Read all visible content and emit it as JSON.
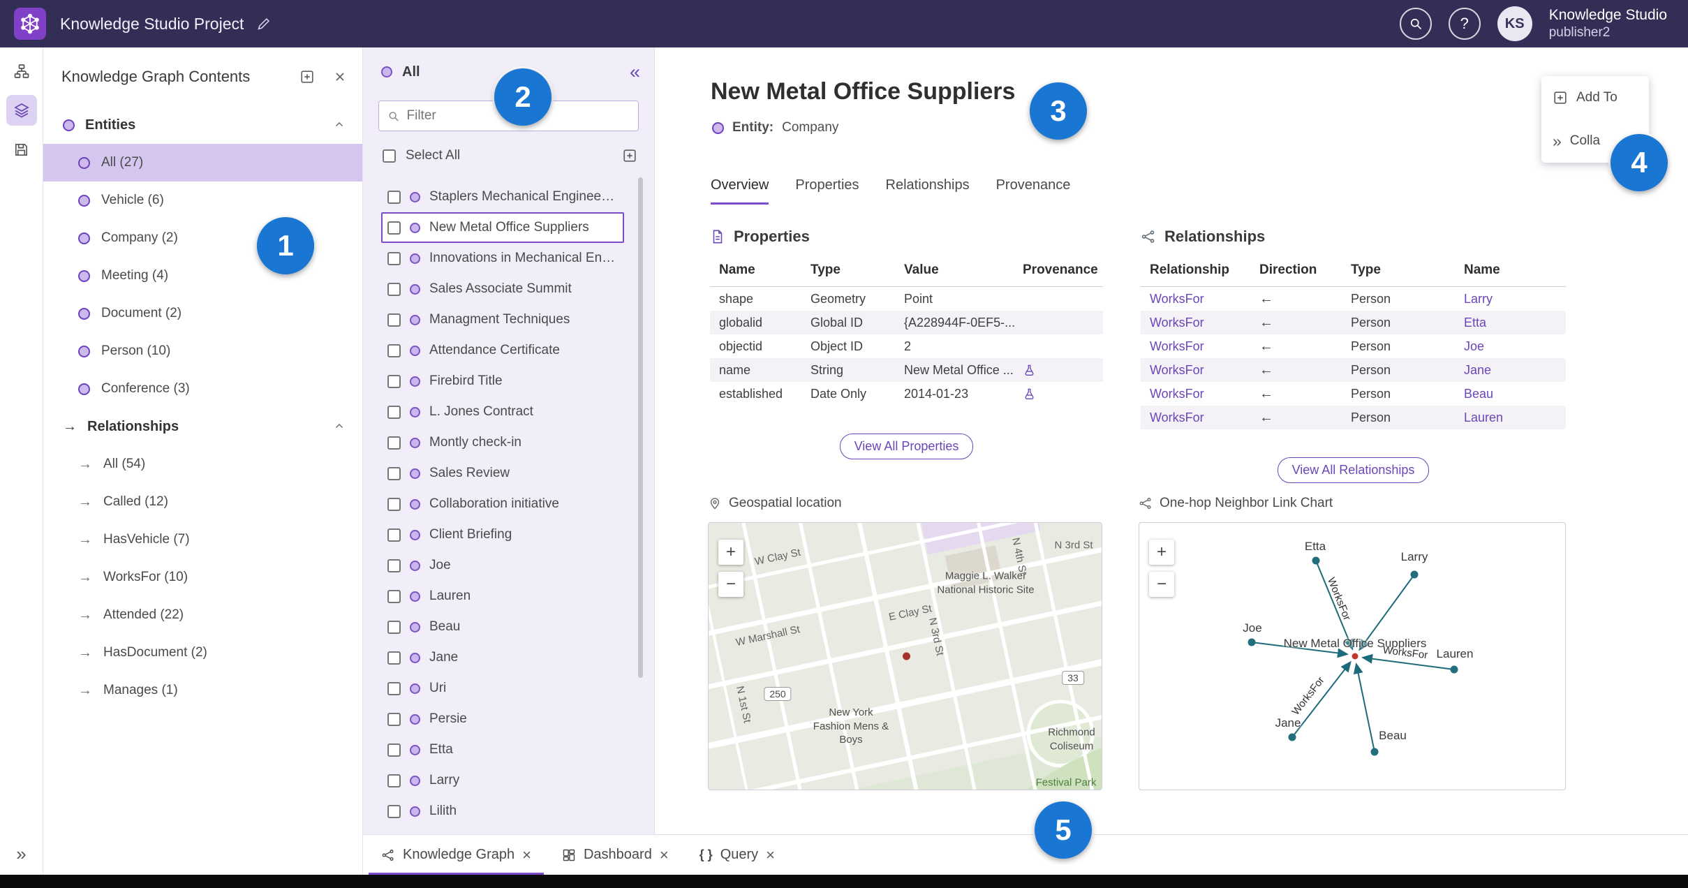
{
  "badges": [
    "1",
    "2",
    "3",
    "4",
    "5"
  ],
  "icons": {
    "help": "?",
    "arrow_right": "→",
    "collapse_double": "«",
    "expand_double": "»",
    "close": "×",
    "zoom_in": "+",
    "zoom_out": "−",
    "braces": "{ }"
  },
  "topbar": {
    "title": "Knowledge Studio Project",
    "avatar_initials": "KS",
    "app_name": "Knowledge Studio",
    "user_name": "publisher2"
  },
  "contents_panel": {
    "title": "Knowledge Graph Contents",
    "entities_header": "Entities",
    "entities": [
      {
        "label": "All (27)",
        "state": "selected"
      },
      {
        "label": "Vehicle (6)"
      },
      {
        "label": "Company (2)"
      },
      {
        "label": "Meeting (4)"
      },
      {
        "label": "Document (2)"
      },
      {
        "label": "Person (10)"
      },
      {
        "label": "Conference (3)"
      }
    ],
    "relationships_header": "Relationships",
    "relationships": [
      {
        "label": "All (54)"
      },
      {
        "label": "Called (12)"
      },
      {
        "label": "HasVehicle (7)"
      },
      {
        "label": "WorksFor (10)"
      },
      {
        "label": "Attended (22)"
      },
      {
        "label": "HasDocument (2)"
      },
      {
        "label": "Manages (1)"
      }
    ]
  },
  "list_panel": {
    "header": "All",
    "filter_placeholder": "Filter",
    "select_all_label": "Select All",
    "items": [
      {
        "label": "Staplers Mechanical Engineering"
      },
      {
        "label": "New Metal Office Suppliers",
        "state": "selected"
      },
      {
        "label": "Innovations in Mechanical Engin..."
      },
      {
        "label": "Sales Associate Summit"
      },
      {
        "label": "Managment Techniques"
      },
      {
        "label": "Attendance Certificate"
      },
      {
        "label": "Firebird Title"
      },
      {
        "label": "L. Jones Contract"
      },
      {
        "label": "Montly check-in"
      },
      {
        "label": "Sales Review"
      },
      {
        "label": "Collaboration initiative"
      },
      {
        "label": "Client Briefing"
      },
      {
        "label": "Joe"
      },
      {
        "label": "Lauren"
      },
      {
        "label": "Beau"
      },
      {
        "label": "Jane"
      },
      {
        "label": "Uri"
      },
      {
        "label": "Persie"
      },
      {
        "label": "Etta"
      },
      {
        "label": "Larry"
      },
      {
        "label": "Lilith"
      }
    ]
  },
  "detail": {
    "title": "New Metal Office Suppliers",
    "entity_key": "Entity:",
    "entity_value": "Company",
    "tabs": [
      {
        "label": "Overview",
        "state": "active"
      },
      {
        "label": "Properties"
      },
      {
        "label": "Relationships"
      },
      {
        "label": "Provenance"
      }
    ],
    "properties": {
      "heading": "Properties",
      "columns": {
        "name": "Name",
        "type": "Type",
        "value": "Value",
        "provenance": "Provenance"
      },
      "rows": [
        {
          "name": "shape",
          "type": "Geometry",
          "value": "Point"
        },
        {
          "name": "globalid",
          "type": "Global ID",
          "value": "{A228944F-0EF5-..."
        },
        {
          "name": "objectid",
          "type": "Object ID",
          "value": "2"
        },
        {
          "name": "name",
          "type": "String",
          "value": "New Metal Office ...",
          "state": "has-prov"
        },
        {
          "name": "established",
          "type": "Date Only",
          "value": "2014-01-23",
          "state": "has-prov"
        }
      ],
      "view_all_label": "View All Properties"
    },
    "relationships": {
      "heading": "Relationships",
      "columns": {
        "relationship": "Relationship",
        "direction": "Direction",
        "type": "Type",
        "name": "Name"
      },
      "rows": [
        {
          "relationship": "WorksFor",
          "direction": "←",
          "type": "Person",
          "name": "Larry"
        },
        {
          "relationship": "WorksFor",
          "direction": "←",
          "type": "Person",
          "name": "Etta"
        },
        {
          "relationship": "WorksFor",
          "direction": "←",
          "type": "Person",
          "name": "Joe"
        },
        {
          "relationship": "WorksFor",
          "direction": "←",
          "type": "Person",
          "name": "Jane"
        },
        {
          "relationship": "WorksFor",
          "direction": "←",
          "type": "Person",
          "name": "Beau"
        },
        {
          "relationship": "WorksFor",
          "direction": "←",
          "type": "Person",
          "name": "Lauren"
        }
      ],
      "view_all_label": "View All Relationships"
    },
    "map": {
      "heading": "Geospatial location",
      "labels": {
        "n3rd_top": "N 3rd St",
        "w_clay": "W Clay St",
        "e_clay": "E Clay St",
        "w_marshall": "W Marshall St",
        "n4th": "N 4th St",
        "n3rd_mid": "N 3rd St",
        "n1st": "N 1st St",
        "shield_250": "250",
        "shield_33": "33",
        "maggie": "Maggie L. Walker National Historic Site",
        "fashion": "New York Fashion Mens & Boys",
        "coliseum": "Richmond Coliseum",
        "festival": "Festival Park"
      }
    },
    "linkchart": {
      "heading": "One-hop Neighbor Link Chart",
      "center_label": "New Metal Office Suppliers",
      "edge_label": "WorksFor",
      "nodes": {
        "etta": "Etta",
        "larry": "Larry",
        "joe": "Joe",
        "lauren": "Lauren",
        "jane": "Jane",
        "beau": "Beau"
      }
    }
  },
  "float_panel": {
    "add_to_label": "Add To",
    "collapse_label": "Colla"
  },
  "bottom_tabs": {
    "knowledge_graph": "Knowledge Graph",
    "dashboard": "Dashboard",
    "query": "Query"
  }
}
